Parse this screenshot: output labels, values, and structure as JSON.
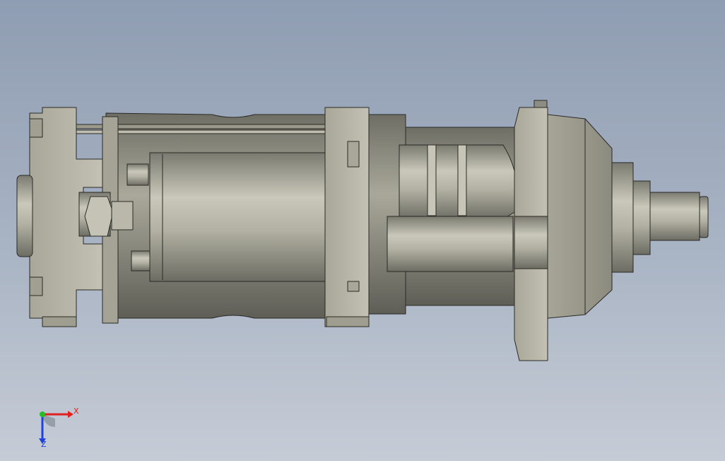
{
  "viewport": {
    "background_top": "#8f9db2",
    "background_bottom": "#c6ccd6"
  },
  "model": {
    "body_color": "#b5b4a5",
    "edge_color": "#2a2a26"
  },
  "triad": {
    "x_label": "X",
    "z_label": "Z",
    "x_color": "#e02020",
    "y_color": "#20c020",
    "z_color": "#2040e0"
  }
}
